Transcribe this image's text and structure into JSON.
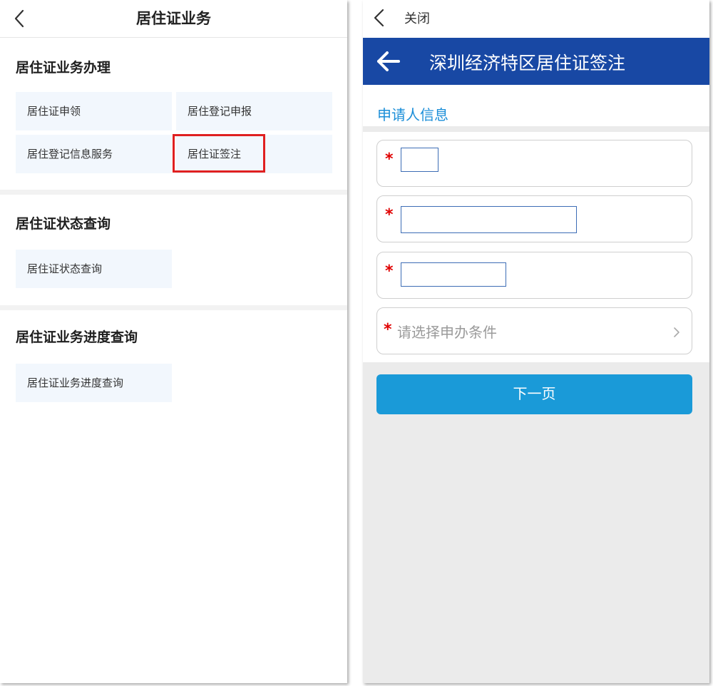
{
  "left": {
    "header": {
      "title": "居住证业务"
    },
    "sections": [
      {
        "title": "居住证业务办理",
        "tiles": [
          "居住证申领",
          "居住登记申报",
          "居住登记信息服务",
          "居住证签注"
        ]
      },
      {
        "title": "居住证状态查询",
        "tiles": [
          "居住证状态查询"
        ]
      },
      {
        "title": "居住证业务进度查询",
        "tiles": [
          "居住证业务进度查询"
        ]
      }
    ],
    "highlight_color": "#e02020"
  },
  "right": {
    "top_bar": {
      "close_label": "关闭"
    },
    "title_bar": {
      "title": "深圳经济特区居住证签注",
      "color": "#1848a4"
    },
    "subheading": "申请人信息",
    "required_mark": "*",
    "fields": [
      {
        "value": ""
      },
      {
        "value": ""
      },
      {
        "value": ""
      }
    ],
    "select": {
      "placeholder": "请选择申办条件"
    },
    "next_button": {
      "label": "下一页",
      "color": "#1a9ad8"
    }
  }
}
